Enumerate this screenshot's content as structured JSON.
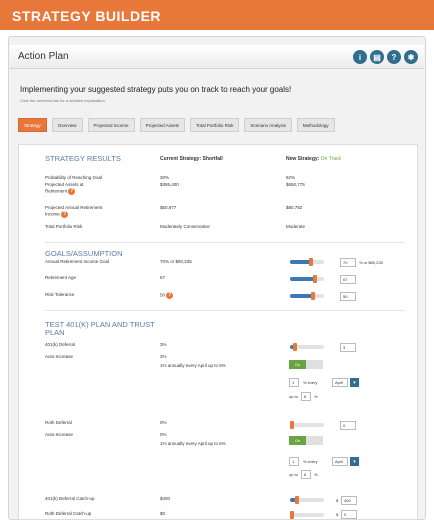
{
  "app": {
    "title": "STRATEGY BUILDER"
  },
  "header": {
    "title": "Action Plan",
    "icons": [
      "info-icon",
      "print-icon",
      "help-icon",
      "settings-icon"
    ]
  },
  "headline": "Implementing your suggested strategy puts you on track to reach your goals!",
  "subline": "Click the overview tab for a detailed explanation",
  "tabs": [
    "Strategy",
    "Overview",
    "Projected Income",
    "Projected Assets",
    "Total Portfolio Risk",
    "Scenario Analysis",
    "Methodology"
  ],
  "results": {
    "heading": "STRATEGY RESULTS",
    "col_current": "Current Strategy: Shortfall",
    "col_new_prefix": "New Strategy:",
    "col_new_status": "On Track",
    "rows": [
      {
        "label": "Probability of Reaching Goal",
        "current": "30%",
        "new": "92%"
      },
      {
        "label": "Projected Assets at Retirement",
        "current": "$395,400",
        "new": "$650,775"
      },
      {
        "label": "Projected Annual Retirement Income",
        "current": "$50,877",
        "new": "$80,782"
      },
      {
        "label": "Total Portfolio Risk",
        "current": "Moderately Conservative",
        "new": "Moderate"
      }
    ]
  },
  "goals": {
    "heading": "GOALS/ASSUMPTION",
    "rows": [
      {
        "label": "Annual Retirement Income Goal",
        "value": "70% or $80,235",
        "box": "70",
        "suffix": "% or $80,235"
      },
      {
        "label": "Retirement Age",
        "value": "67",
        "box": "67"
      },
      {
        "label": "Risk Tolerance",
        "value": "50",
        "box": "50"
      }
    ]
  },
  "plan": {
    "heading": "TEST 401(K) PLAN AND TRUST PLAN",
    "rows": [
      {
        "label": "401(k) Deferral",
        "value": "3%",
        "box": "3"
      },
      {
        "label": "Auto-Increase",
        "value": "3%",
        "note": "1% annually every April up to 6%"
      },
      {
        "label": "Roth Deferral",
        "value": "0%",
        "box": "0"
      },
      {
        "label": "Auto-Increase",
        "value": "0%",
        "note": "1% annually every April up to 6%"
      },
      {
        "label": "401(k) Deferral Catch-up",
        "value": "$400",
        "box": "400"
      },
      {
        "label": "Roth Deferral Catch-up",
        "value": "$0",
        "box": "0"
      }
    ],
    "toggle_on": "On",
    "increment_box": "1",
    "increment_text": "% every",
    "month": "April",
    "upto_text": "up to",
    "upto_box": "6",
    "pct": "%",
    "dollar": "$"
  },
  "colors": {
    "brand": "#e8773a",
    "accent": "#3b79b5",
    "icon": "#2f6e8f",
    "heading": "#5b7aa8",
    "success": "#6aa344"
  }
}
